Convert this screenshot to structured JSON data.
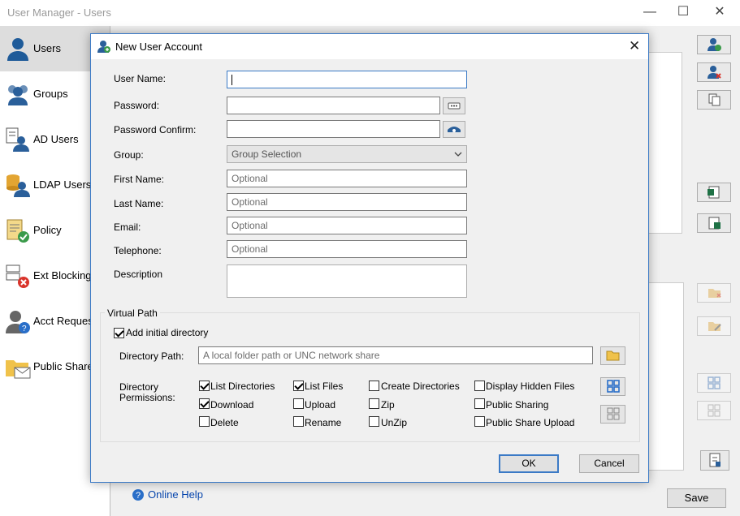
{
  "window": {
    "title": "User Manager - Users",
    "minimize": "—",
    "maximize": "☐",
    "close": "✕"
  },
  "sidebar": {
    "items": [
      {
        "label": "Users",
        "icon": "user-icon"
      },
      {
        "label": "Groups",
        "icon": "group-icon"
      },
      {
        "label": "AD Users",
        "icon": "ad-users-icon"
      },
      {
        "label": "LDAP Users",
        "icon": "ldap-users-icon"
      },
      {
        "label": "Policy",
        "icon": "policy-icon"
      },
      {
        "label": "Ext Blocking",
        "icon": "ext-blocking-icon"
      },
      {
        "label": "Acct Request",
        "icon": "acct-request-icon"
      },
      {
        "label": "Public Shares",
        "icon": "public-shares-icon"
      }
    ]
  },
  "footer": {
    "online_help": "Online Help",
    "save": "Save"
  },
  "dialog": {
    "title": "New User Account",
    "close": "✕",
    "fields": {
      "username_label": "User Name:",
      "username_value": "",
      "password_label": "Password:",
      "password_confirm_label": "Password Confirm:",
      "group_label": "Group:",
      "group_value": "Group Selection",
      "first_name_label": "First Name:",
      "first_name_placeholder": "Optional",
      "last_name_label": "Last Name:",
      "last_name_placeholder": "Optional",
      "email_label": "Email:",
      "email_placeholder": "Optional",
      "telephone_label": "Telephone:",
      "telephone_placeholder": "Optional",
      "description_label": "Description"
    },
    "virtual_path": {
      "group_label": "Virtual Path",
      "add_initial_dir_label": "Add initial directory",
      "add_initial_dir_checked": true,
      "directory_path_label": "Directory Path:",
      "directory_path_placeholder": "A local folder path or UNC network share",
      "permissions_label_line1": "Directory",
      "permissions_label_line2": "Permissions:",
      "permissions": [
        {
          "label": "List Directories",
          "checked": true
        },
        {
          "label": "List Files",
          "checked": true
        },
        {
          "label": "Create Directories",
          "checked": false
        },
        {
          "label": "Display Hidden Files",
          "checked": false
        },
        {
          "label": "Download",
          "checked": true
        },
        {
          "label": "Upload",
          "checked": false
        },
        {
          "label": "Zip",
          "checked": false
        },
        {
          "label": "Public Sharing",
          "checked": false
        },
        {
          "label": "Delete",
          "checked": false
        },
        {
          "label": "Rename",
          "checked": false
        },
        {
          "label": "UnZip",
          "checked": false
        },
        {
          "label": "Public Share Upload",
          "checked": false
        }
      ]
    },
    "ok": "OK",
    "cancel": "Cancel"
  },
  "colors": {
    "accent": "#3b7ac6",
    "link": "#0645ad",
    "user_icon": "#1f5b99"
  }
}
